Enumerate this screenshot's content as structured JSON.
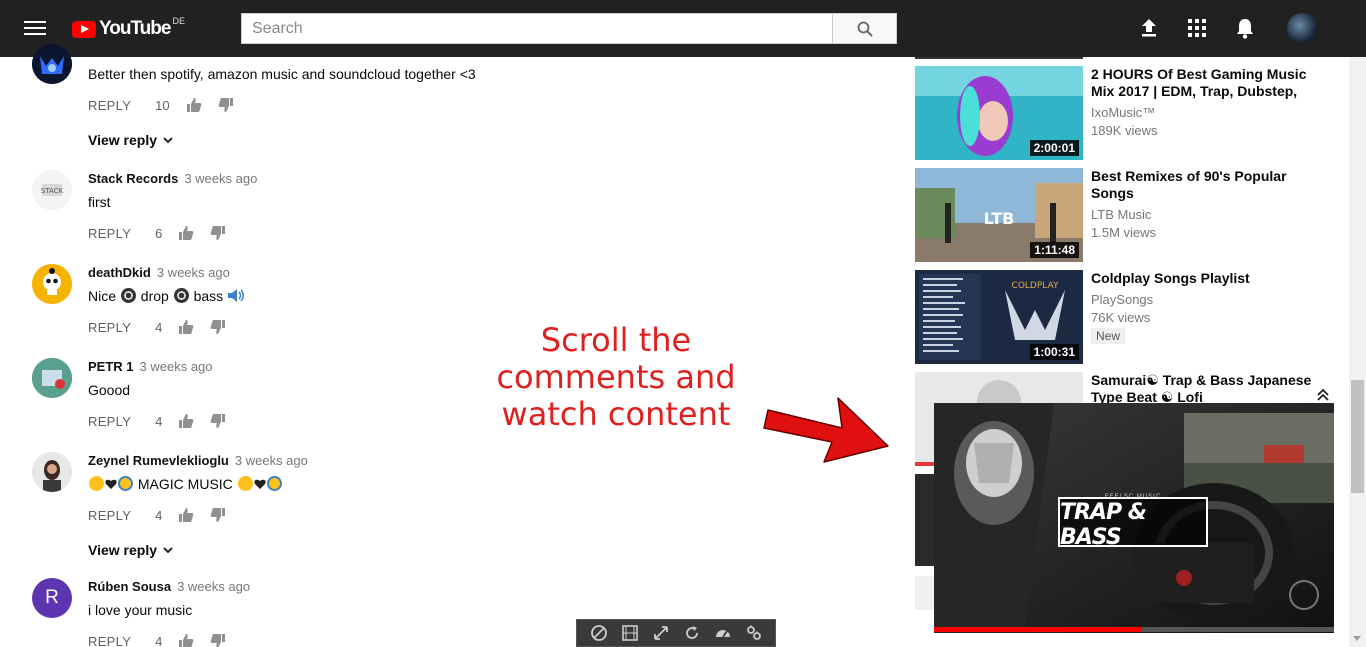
{
  "header": {
    "logo_text": "YouTube",
    "region": "DE",
    "search_placeholder": "Search",
    "icons": [
      "menu-icon",
      "upload-icon",
      "apps-icon",
      "bell-icon",
      "account-avatar"
    ]
  },
  "comments": [
    {
      "author": "",
      "time": "",
      "text": "Better then spotify, amazon music and soundcloud together <3",
      "reply_label": "REPLY",
      "likes": "10",
      "view_reply": "View reply"
    },
    {
      "author": "Stack Records",
      "time": "3 weeks ago",
      "text": "first",
      "reply_label": "REPLY",
      "likes": "6"
    },
    {
      "author": "deathDkid",
      "time": "3 weeks ago",
      "text_parts": [
        "Nice ",
        " drop ",
        " bass "
      ],
      "reply_label": "REPLY",
      "likes": "4"
    },
    {
      "author": "PETR 1",
      "time": "3 weeks ago",
      "text": "Goood",
      "reply_label": "REPLY",
      "likes": "4"
    },
    {
      "author": "Zeynel Rumevleklioglu",
      "time": "3 weeks ago",
      "text": " MAGIC MUSIC ",
      "reply_label": "REPLY",
      "likes": "4",
      "view_reply": "View reply"
    },
    {
      "author": "Rúben Sousa",
      "time": "3 weeks ago",
      "text": "i love your music",
      "avatar_letter": "R",
      "reply_label": "REPLY",
      "likes": "4"
    }
  ],
  "related": [
    {
      "title": "2 HOURS Of Best Gaming Music Mix 2017 | EDM, Trap, Dubstep,",
      "channel": "IxoMusic™",
      "views": "189K views",
      "duration": "2:00:01"
    },
    {
      "title": "Best Remixes of 90's Popular Songs",
      "channel": "LTB Music",
      "views": "1.5M views",
      "duration": "1:11:48",
      "thumb_text": "LTB"
    },
    {
      "title": "Coldplay Songs Playlist",
      "channel": "PlaySongs",
      "views": "76K views",
      "duration": "1:00:31",
      "badge": "New",
      "thumb_text": "COLDPLAY"
    },
    {
      "title": "Samurai☯ Trap & Bass Japanese Type Beat ☯ Lofi"
    }
  ],
  "mini_player": {
    "brand_small": "TRAP & BASS",
    "brand_small_top": "FEELSC MUSIC",
    "progress": 0.52
  },
  "annotation": {
    "line1": "Scroll the",
    "line2": "comments and",
    "line3": "watch content"
  },
  "colors": {
    "header_bg": "#212121",
    "accent_red": "#ff0000",
    "annotation_red": "#e02020"
  }
}
